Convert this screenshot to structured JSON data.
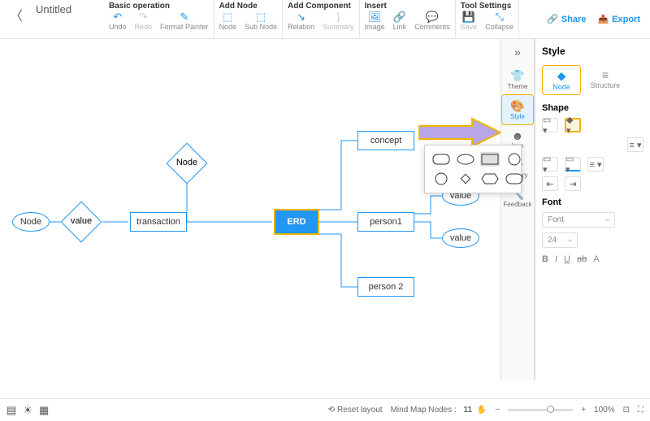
{
  "header": {
    "title": "Untitled",
    "share": "Share",
    "export": "Export"
  },
  "ribbon": {
    "groups": [
      {
        "title": "Basic operation",
        "buttons": [
          "Undo",
          "Redo",
          "Format Painter"
        ]
      },
      {
        "title": "Add Node",
        "buttons": [
          "Node",
          "Sub Node"
        ]
      },
      {
        "title": "Add Component",
        "buttons": [
          "Relation",
          "Summary"
        ]
      },
      {
        "title": "Insert",
        "buttons": [
          "Image",
          "Link",
          "Comments"
        ]
      },
      {
        "title": "Tool Settings",
        "buttons": [
          "Save",
          "Collapse"
        ]
      }
    ]
  },
  "rail": {
    "collapse": "»",
    "items": [
      {
        "label": "Theme",
        "icon": "👕"
      },
      {
        "label": "Style",
        "icon": "🎨",
        "active": true
      },
      {
        "label": "Icon",
        "icon": "☻"
      },
      {
        "label": "History",
        "icon": "⟲"
      },
      {
        "label": "Feedback",
        "icon": "🔧"
      }
    ]
  },
  "panel": {
    "title": "Style",
    "tabs": [
      {
        "label": "Node",
        "icon": "◆",
        "active": true
      },
      {
        "label": "Structure",
        "icon": "≡"
      }
    ],
    "shape_label": "Shape",
    "font_label": "Font",
    "font_family": "Font",
    "font_size": "24",
    "fmt": {
      "b": "B",
      "i": "I",
      "u": "U",
      "s": "ab",
      "color": "A"
    }
  },
  "diagram": {
    "root": "ERD",
    "left_branch": {
      "n1": "Node",
      "n2": "value",
      "n3": "transaction"
    },
    "top_branch": "Node",
    "right": {
      "concept": "concept",
      "person1": "person1",
      "person2": "person 2",
      "value1": "value",
      "value2": "value"
    }
  },
  "status": {
    "reset": "Reset layout",
    "nodes_label": "Mind Map Nodes :",
    "nodes_count": "11",
    "zoom_minus": "−",
    "zoom_plus": "+",
    "zoom_pct": "100%"
  }
}
